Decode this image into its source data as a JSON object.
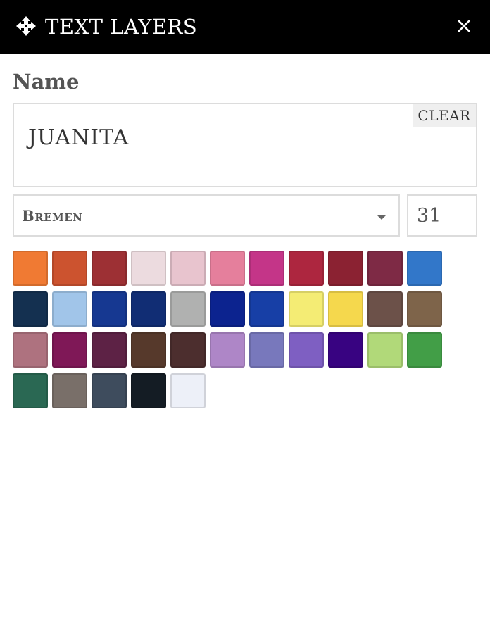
{
  "header": {
    "title": "TEXT LAYERS",
    "move_icon": "move-arrows-icon",
    "close_icon": "close-icon"
  },
  "name_section": {
    "label": "Name",
    "value": "JUANITA",
    "clear_label": "CLEAR"
  },
  "font": {
    "selected": "Bremen"
  },
  "size": {
    "value": "31"
  },
  "swatches": [
    "#f07a33",
    "#cc532f",
    "#9d3034",
    "#ecdbdf",
    "#e8c4ce",
    "#e57f9c",
    "#c43588",
    "#ad263f",
    "#8b2232",
    "#7e2a45",
    "#3277c9",
    "#143050",
    "#a1c5e9",
    "#163891",
    "#112d74",
    "#b0b1b0",
    "#0c238f",
    "#173fa6",
    "#f4ec74",
    "#f5d84d",
    "#6c5149",
    "#7e644a",
    "#ae727f",
    "#7f1857",
    "#5d2245",
    "#56392b",
    "#4c2e2e",
    "#ae86c7",
    "#7878bc",
    "#7e5fc2",
    "#380381",
    "#b1d979",
    "#429e47",
    "#2a6853",
    "#796f69",
    "#3e4c5d",
    "#141c24",
    "#edf0f8"
  ]
}
